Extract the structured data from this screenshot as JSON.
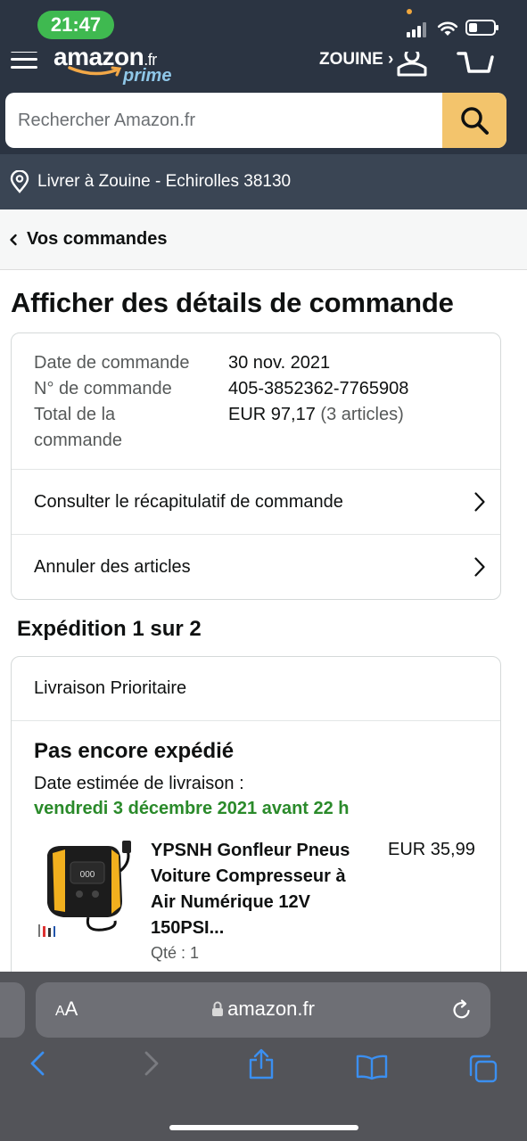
{
  "status_bar": {
    "time": "21:47"
  },
  "header": {
    "logo_text": "amazon",
    "logo_tld": ".fr",
    "logo_prime": "prime",
    "account_label": "ZOUINE ›",
    "search_placeholder": "Rechercher Amazon.fr",
    "deliver_to": "Livrer à Zouine - Echirolles 38130"
  },
  "breadcrumb": {
    "back_label": "Vos commandes"
  },
  "page_title": "Afficher des détails de commande",
  "order_info": {
    "rows": [
      {
        "label": "Date de commande",
        "value": "30 nov. 2021"
      },
      {
        "label": "N° de commande",
        "value": "405-3852362-7765908"
      }
    ],
    "total_label": "Total de la commande",
    "total_value": "EUR 97,17",
    "total_count": "(3 articles)",
    "links": [
      {
        "label": "Consulter le récapitulatif de commande"
      },
      {
        "label": "Annuler des articles"
      }
    ]
  },
  "shipment": {
    "heading": "Expédition 1 sur 2",
    "type": "Livraison Prioritaire",
    "status": "Pas encore expédié",
    "estimate_label": "Date estimée de livraison :",
    "estimate_date": "vendredi 3 décembre 2021 avant 22 h",
    "item": {
      "title": "YPSNH Gonfleur Pneus Voiture Compresseur à Air Numérique 12V 150PSI...",
      "price": "EUR 35,99",
      "qty": "Qté : 1"
    }
  },
  "browser": {
    "aa_label": "AA",
    "url": "amazon.fr"
  },
  "colors": {
    "header_bg": "#2b3442",
    "search_button": "#f3c46c",
    "delivery_green": "#2a8a2a",
    "safari_toolbar": "#535459",
    "ios_blue": "#3b8ff0"
  }
}
